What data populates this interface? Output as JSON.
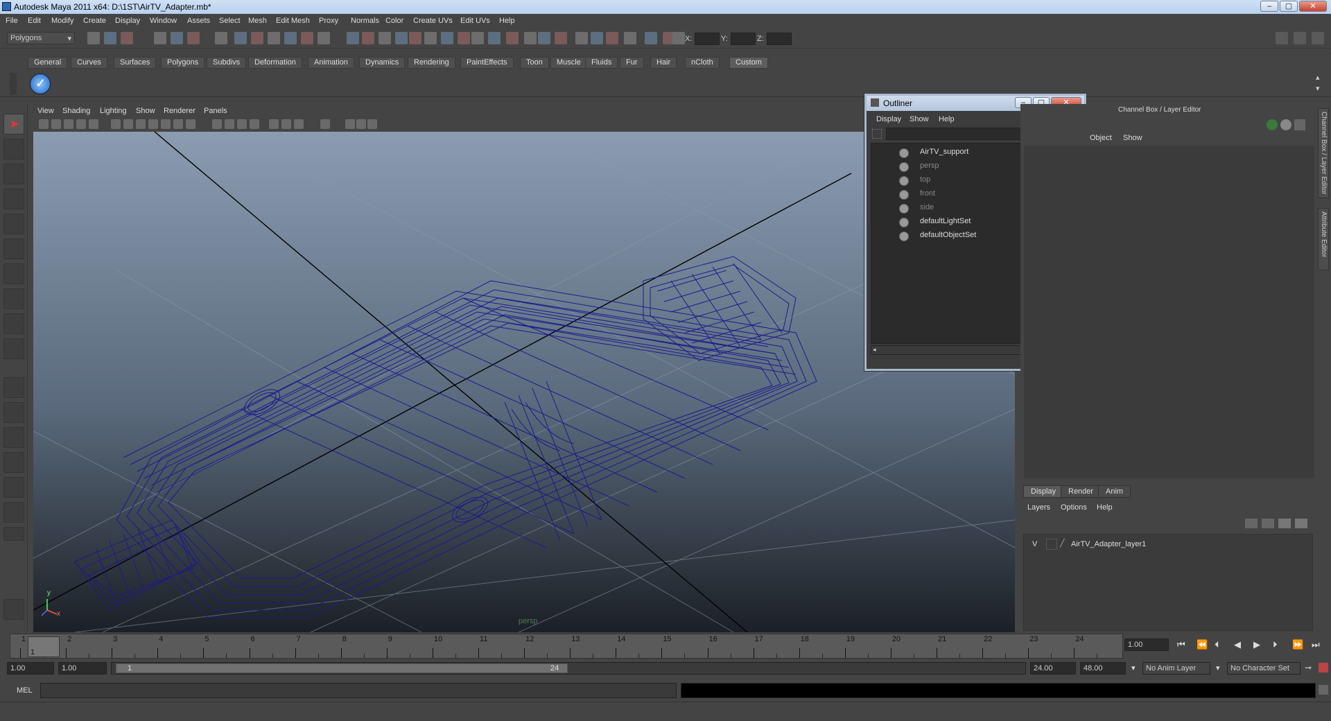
{
  "window": {
    "title": "Autodesk Maya 2011 x64: D:\\1ST\\AirTV_Adapter.mb*"
  },
  "menubar": [
    "File",
    "Edit",
    "Modify",
    "Create",
    "Display",
    "Window",
    "Assets",
    "Select",
    "Mesh",
    "Edit Mesh",
    "Proxy",
    "Normals",
    "Color",
    "Create UVs",
    "Edit UVs",
    "Help"
  ],
  "statusline": {
    "mode": "Polygons",
    "x_label": "X:",
    "y_label": "Y:",
    "z_label": "Z:"
  },
  "shelf_tabs": [
    "General",
    "Curves",
    "Surfaces",
    "Polygons",
    "Subdivs",
    "Deformation",
    "Animation",
    "Dynamics",
    "Rendering",
    "PaintEffects",
    "Toon",
    "Muscle",
    "Fluids",
    "Fur",
    "Hair",
    "nCloth",
    "Custom"
  ],
  "shelf_active": "Custom",
  "viewport": {
    "menu": [
      "View",
      "Shading",
      "Lighting",
      "Show",
      "Renderer",
      "Panels"
    ],
    "camera_label": "persp",
    "axis_y": "y",
    "axis_x": "x",
    "wire_color": "#1b1b8a"
  },
  "outliner": {
    "title": "Outliner",
    "menu": [
      "Display",
      "Show",
      "Help"
    ],
    "items": [
      {
        "label": "AirTV_support",
        "dim": false
      },
      {
        "label": "persp",
        "dim": true
      },
      {
        "label": "top",
        "dim": true
      },
      {
        "label": "front",
        "dim": true
      },
      {
        "label": "side",
        "dim": true
      },
      {
        "label": "defaultLightSet",
        "dim": false
      },
      {
        "label": "defaultObjectSet",
        "dim": false
      }
    ]
  },
  "channelbox": {
    "title": "Channel Box / Layer Editor",
    "menu": [
      "Object",
      "Show"
    ]
  },
  "layer_editor": {
    "tabs": [
      "Display",
      "Render",
      "Anim"
    ],
    "active_tab": "Display",
    "menu": [
      "Layers",
      "Options",
      "Help"
    ],
    "layer": {
      "visible": "V",
      "name": "AirTV_Adapter_layer1"
    }
  },
  "side_tabs": [
    "Channel Box / Layer Editor",
    "Attribute Editor"
  ],
  "timeslider": {
    "ticks": [
      "1",
      "2",
      "3",
      "4",
      "5",
      "6",
      "7",
      "8",
      "9",
      "10",
      "11",
      "12",
      "13",
      "14",
      "15",
      "16",
      "17",
      "18",
      "19",
      "20",
      "21",
      "22",
      "23",
      "24"
    ],
    "current_frame_marker": "1",
    "current_time": "1.00"
  },
  "range": {
    "start_time": "1.00",
    "playback_start": "1.00",
    "range_start_label": "1",
    "range_end_label": "24",
    "playback_end": "24.00",
    "end_time": "48.00",
    "anim_layer": "No Anim Layer",
    "character_set": "No Character Set"
  },
  "cmdline": {
    "label": "MEL"
  }
}
